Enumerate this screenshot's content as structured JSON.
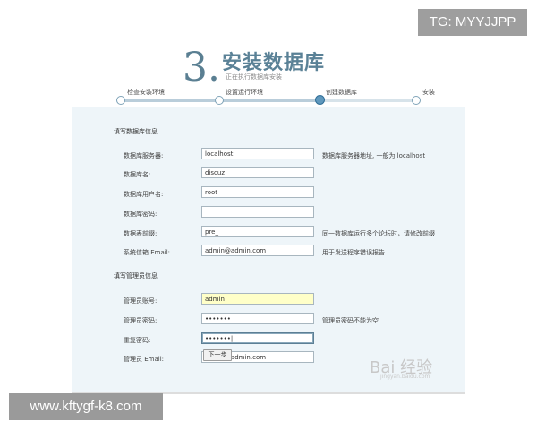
{
  "watermarks": {
    "top": "TG: MYYJJPP",
    "bottom": "www.kftygf-k8.com"
  },
  "header": {
    "step_number": "3.",
    "title": "安装数据库",
    "subtitle": "正在执行数据库安装"
  },
  "steps": [
    {
      "label": "检查安装环境",
      "state": "done"
    },
    {
      "label": "设置运行环境",
      "state": "done"
    },
    {
      "label": "创建数据库",
      "state": "active"
    },
    {
      "label": "安装",
      "state": "todo"
    }
  ],
  "db_section": {
    "title": "填写数据库信息",
    "rows": [
      {
        "label": "数据库服务器:",
        "value": "localhost",
        "hint": "数据库服务器地址, 一般为 localhost"
      },
      {
        "label": "数据库名:",
        "value": "discuz",
        "hint": ""
      },
      {
        "label": "数据库用户名:",
        "value": "root",
        "hint": ""
      },
      {
        "label": "数据库密码:",
        "value": "",
        "hint": ""
      },
      {
        "label": "数据表前缀:",
        "value": "pre_",
        "hint": "同一数据库运行多个论坛时，请修改前缀"
      },
      {
        "label": "系统信箱 Email:",
        "value": "admin@admin.com",
        "hint": "用于发送程序错误报告"
      }
    ]
  },
  "admin_section": {
    "title": "填写管理员信息",
    "rows": [
      {
        "label": "管理员账号:",
        "value": "admin",
        "hint": ""
      },
      {
        "label": "管理员密码:",
        "value": "•••••••",
        "hint": "管理员密码不能为空"
      },
      {
        "label": "重复密码:",
        "value": "•••••••|",
        "hint": ""
      },
      {
        "label": "管理员 Email:",
        "value": "admin@admin.com",
        "hint": ""
      }
    ]
  },
  "buttons": {
    "next": "下一步"
  },
  "logo_watermark": {
    "text": "Bai 经验",
    "sub": "jingyan.baidu.com"
  }
}
